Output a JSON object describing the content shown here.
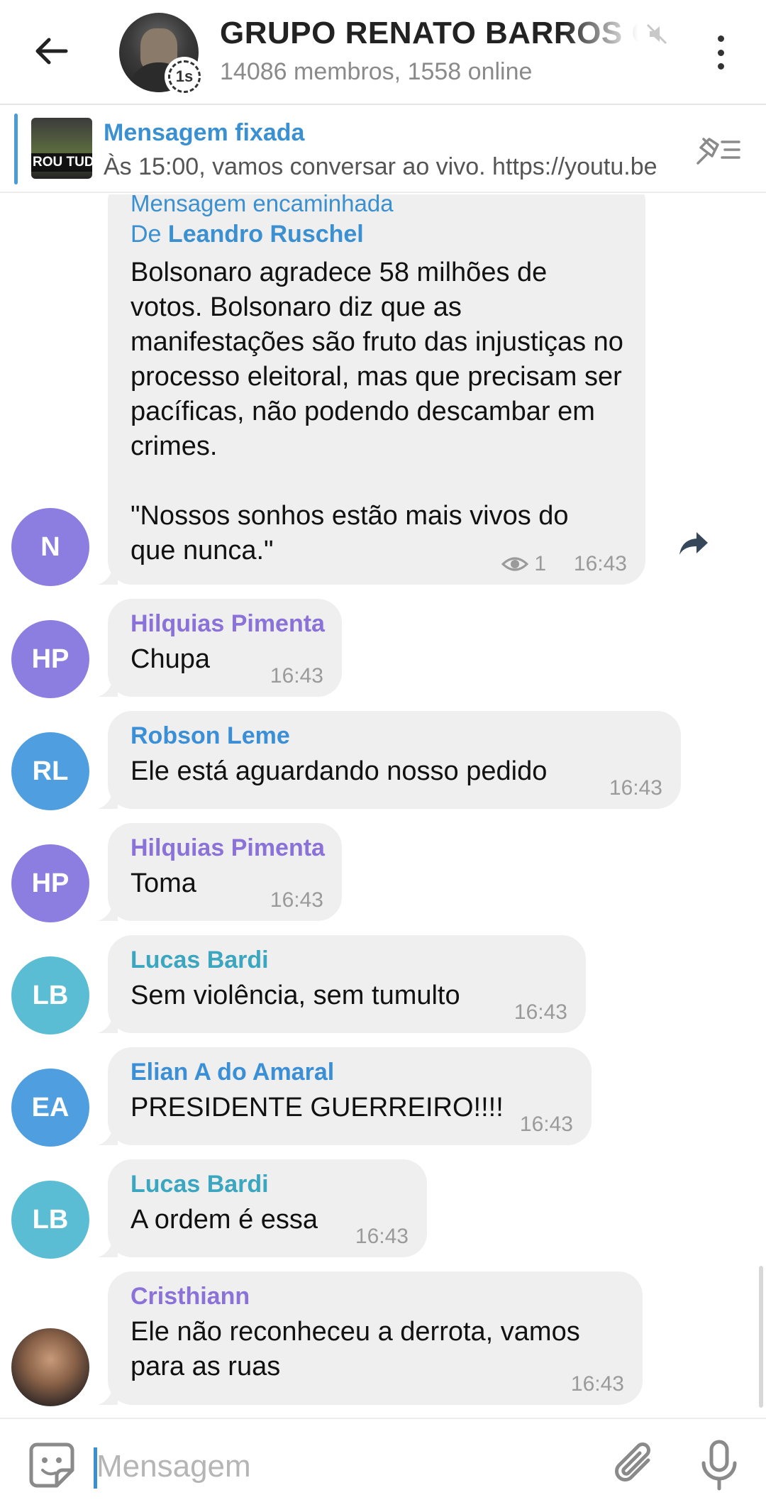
{
  "header": {
    "title": "GRUPO RENATO BARROS Q",
    "subtitle": "14086 membros, 1558 online",
    "timer_badge": "1s",
    "icons": [
      "back-arrow-icon",
      "mute-icon",
      "more-vert-icon"
    ]
  },
  "pinned": {
    "title": "Mensagem fixada",
    "text": "Às 15:00, vamos conversar ao vivo.  https://youtu.be",
    "thumb_text": "ROU TUD"
  },
  "messages": [
    {
      "avatar_initials": "N",
      "avatar_color": "#8b7ee0",
      "forwarded_label": "Mensagem encaminhada",
      "forwarded_prefix": "De ",
      "forwarded_from": "Leandro Ruschel",
      "text": "Bolsonaro agradece 58 milhões de votos. Bolsonaro diz que as manifestações são fruto das injustiças no processo eleitoral, mas que precisam ser pacíficas, não podendo descambar em crimes.",
      "text2": "\"Nossos sonhos estão mais vivos do que nunca.\"",
      "views": "1",
      "time": "16:43"
    },
    {
      "sender": "Hilquias Pimenta",
      "sender_color": "#8a72d8",
      "avatar_initials": "HP",
      "avatar_color": "#8b7ee0",
      "text": "Chupa",
      "time": "16:43"
    },
    {
      "sender": "Robson Leme",
      "sender_color": "#3a8fd6",
      "avatar_initials": "RL",
      "avatar_color": "#4e9ee0",
      "text": "Ele está aguardando nosso pedido",
      "time": "16:43"
    },
    {
      "sender": "Hilquias Pimenta",
      "sender_color": "#8a72d8",
      "avatar_initials": "HP",
      "avatar_color": "#8b7ee0",
      "text": "Toma",
      "time": "16:43"
    },
    {
      "sender": "Lucas Bardi",
      "sender_color": "#3aa6bf",
      "avatar_initials": "LB",
      "avatar_color": "#5bbdd4",
      "text": "Sem violência, sem tumulto",
      "time": "16:43"
    },
    {
      "sender": "Elian A do Amaral",
      "sender_color": "#3a8fd6",
      "avatar_initials": "EA",
      "avatar_color": "#4e9ee0",
      "text": "PRESIDENTE GUERREIRO!!!!",
      "time": "16:43"
    },
    {
      "sender": "Lucas Bardi",
      "sender_color": "#3aa6bf",
      "avatar_initials": "LB",
      "avatar_color": "#5bbdd4",
      "text": "A ordem é essa",
      "time": "16:43"
    },
    {
      "sender": "Cristhiann",
      "sender_color": "#8a72d8",
      "avatar_initials": "",
      "avatar_color": "#6b5548",
      "text": "Ele não reconheceu a derrota, vamos para as ruas",
      "time": "16:43"
    }
  ],
  "input": {
    "placeholder": "Mensagem"
  }
}
